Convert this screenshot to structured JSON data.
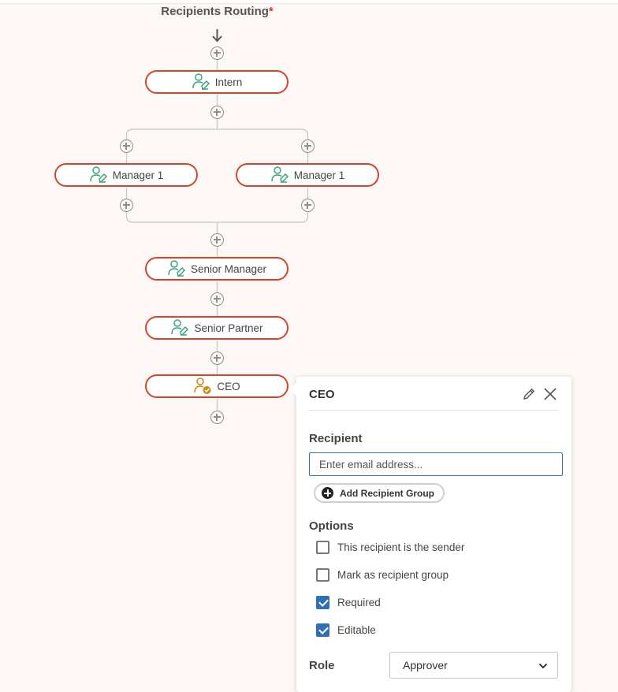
{
  "header": {
    "title": "Recipients Routing",
    "required_marker": "*"
  },
  "flow": {
    "nodes": [
      {
        "label": "Intern",
        "icon": "signer-icon"
      },
      {
        "label": "Manager 1",
        "icon": "signer-icon"
      },
      {
        "label": "Manager 1",
        "icon": "signer-icon"
      },
      {
        "label": "Senior Manager",
        "icon": "signer-icon"
      },
      {
        "label": "Senior Partner",
        "icon": "signer-icon"
      },
      {
        "label": "CEO",
        "icon": "approver-icon"
      }
    ],
    "colors": {
      "node_border": "#d2452c",
      "signer_icon": "#3aa57c",
      "approver_icon": "#d0860f",
      "connector": "#c8c8c8"
    }
  },
  "panel": {
    "title": "CEO",
    "recipient_label": "Recipient",
    "email_placeholder": "Enter email address...",
    "add_group_label": "Add Recipient Group",
    "options_label": "Options",
    "options": [
      {
        "label": "This recipient is the sender",
        "checked": false
      },
      {
        "label": "Mark as recipient group",
        "checked": false
      },
      {
        "label": "Required",
        "checked": true
      },
      {
        "label": "Editable",
        "checked": true
      }
    ],
    "role_label": "Role",
    "role_value": "Approver",
    "accent": "#2f6fba"
  }
}
